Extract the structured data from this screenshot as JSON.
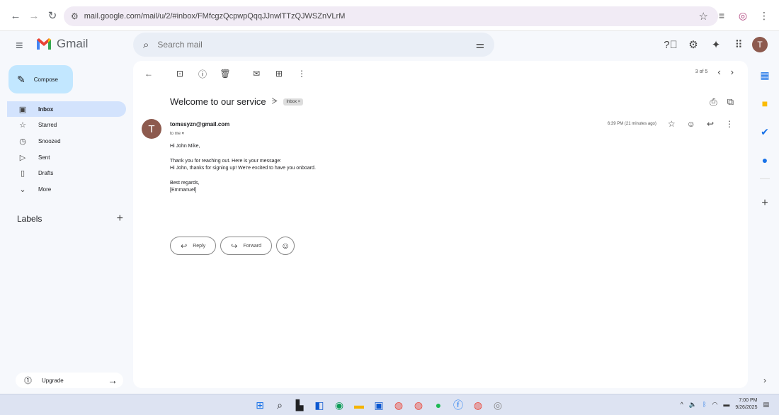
{
  "browser": {
    "url": "mail.google.com/mail/u/2/#inbox/FMfcgzQcpwpQqqJJnwlTTzQJWSZnVLrM"
  },
  "app": {
    "name": "Gmail"
  },
  "search": {
    "placeholder": "Search mail"
  },
  "sidebar": {
    "compose_label": "Compose",
    "items": [
      {
        "label": "Inbox",
        "icon": "inbox-icon"
      },
      {
        "label": "Starred",
        "icon": "star-icon"
      },
      {
        "label": "Snoozed",
        "icon": "clock-icon"
      },
      {
        "label": "Sent",
        "icon": "send-icon"
      },
      {
        "label": "Drafts",
        "icon": "draft-icon"
      },
      {
        "label": "More",
        "icon": "chevron-down-icon"
      }
    ],
    "labels_title": "Labels",
    "upgrade_label": "Upgrade"
  },
  "toolbar": {
    "pager_text": "3 of 5"
  },
  "email": {
    "subject": "Welcome to our service",
    "label_chip": "Inbox",
    "sender": "tomssyzn@gmail.com",
    "to": "to me",
    "time": "6:39 PM (21 minutes ago)",
    "avatar_letter": "T",
    "body": {
      "greeting": "Hi John Mike,",
      "line1": "Thank you for reaching out. Here is your message:",
      "line2": "Hi John, thanks for signing up! We're excited to have you onboard.",
      "signoff": "Best regards,",
      "signature": "[Emmanuel]"
    },
    "reply_label": "Reply",
    "forward_label": "Forward"
  },
  "taskbar": {
    "time": "7:00 PM",
    "date": "9/26/2025"
  },
  "colors": {
    "compose_bg": "#c2e7ff",
    "active_nav_bg": "#d3e3fd",
    "avatar_bg": "#8d5a4e",
    "search_bg": "#e9eef6"
  }
}
